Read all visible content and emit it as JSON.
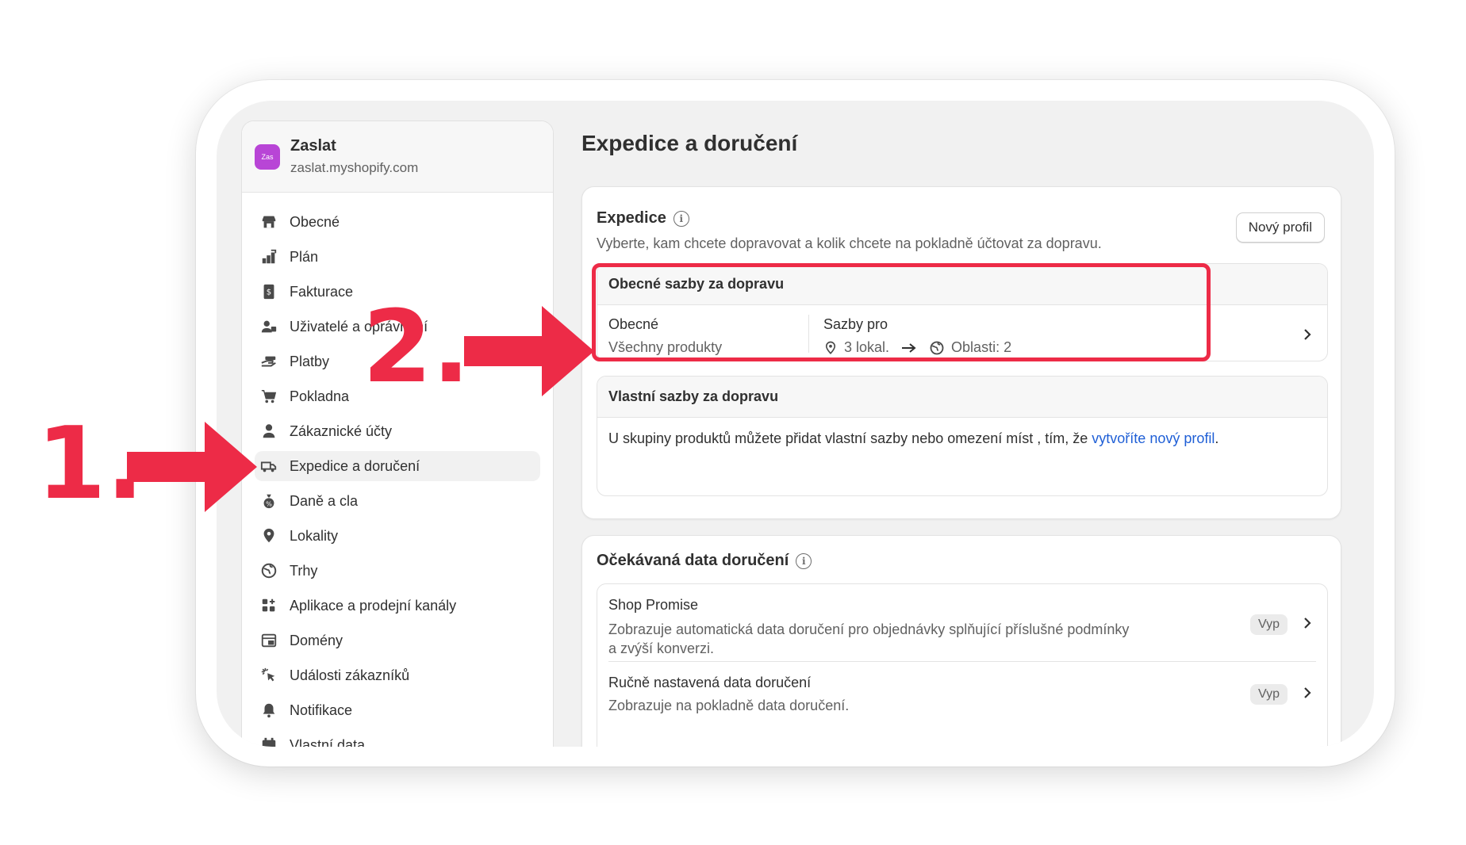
{
  "store": {
    "logo_text": "Zas",
    "name": "Zaslat",
    "domain": "zaslat.myshopify.com"
  },
  "sidebar": {
    "items": [
      {
        "label": "Obecné",
        "icon": "store-icon"
      },
      {
        "label": "Plán",
        "icon": "plan-icon"
      },
      {
        "label": "Fakturace",
        "icon": "billing-icon"
      },
      {
        "label": "Uživatelé a oprávnění",
        "icon": "users-icon"
      },
      {
        "label": "Platby",
        "icon": "payments-icon"
      },
      {
        "label": "Pokladna",
        "icon": "cart-icon"
      },
      {
        "label": "Zákaznické účty",
        "icon": "person-icon"
      },
      {
        "label": "Expedice a doručení",
        "icon": "truck-icon",
        "active": true
      },
      {
        "label": "Daně a cla",
        "icon": "tax-icon"
      },
      {
        "label": "Lokality",
        "icon": "location-icon"
      },
      {
        "label": "Trhy",
        "icon": "globe-icon"
      },
      {
        "label": "Aplikace a prodejní kanály",
        "icon": "apps-icon"
      },
      {
        "label": "Domény",
        "icon": "domain-icon"
      },
      {
        "label": "Události zákazníků",
        "icon": "cursor-icon"
      },
      {
        "label": "Notifikace",
        "icon": "bell-icon"
      },
      {
        "label": "Vlastní data",
        "icon": "data-icon"
      }
    ]
  },
  "page": {
    "title": "Expedice a doručení"
  },
  "shipping": {
    "title": "Expedice",
    "description": "Vyberte, kam chcete dopravovat a kolik chcete na pokladně účtovat za dopravu.",
    "new_profile_button": "Nový profil",
    "general_rates": {
      "header": "Obecné sazby za dopravu",
      "profile_name": "Obecné",
      "profile_products": "Všechny produkty",
      "rates_for_label": "Sazby pro",
      "locations": "3 lokal.",
      "zones": "Oblasti: 2"
    },
    "custom_rates": {
      "header": "Vlastní sazby za dopravu",
      "text": "U skupiny produktů můžete přidat vlastní sazby nebo omezení míst , tím, že",
      "link": "vytvoříte nový profil",
      "text_end": "."
    }
  },
  "delivery": {
    "title": "Očekávaná data doručení",
    "items": [
      {
        "title": "Shop Promise",
        "description": "Zobrazuje automatická data doručení pro objednávky splňující příslušné podmínky a zvýší konverzi.",
        "status": "Vyp"
      },
      {
        "title": "Ručně nastavená data doručení",
        "description": "Zobrazuje na pokladně data doručení.",
        "status": "Vyp"
      }
    ]
  },
  "annotations": {
    "step1": "1.",
    "step2": "2."
  },
  "colors": {
    "annotation": "#ed2b47",
    "link": "#1f5fd6",
    "store_logo": "#b845d6"
  }
}
